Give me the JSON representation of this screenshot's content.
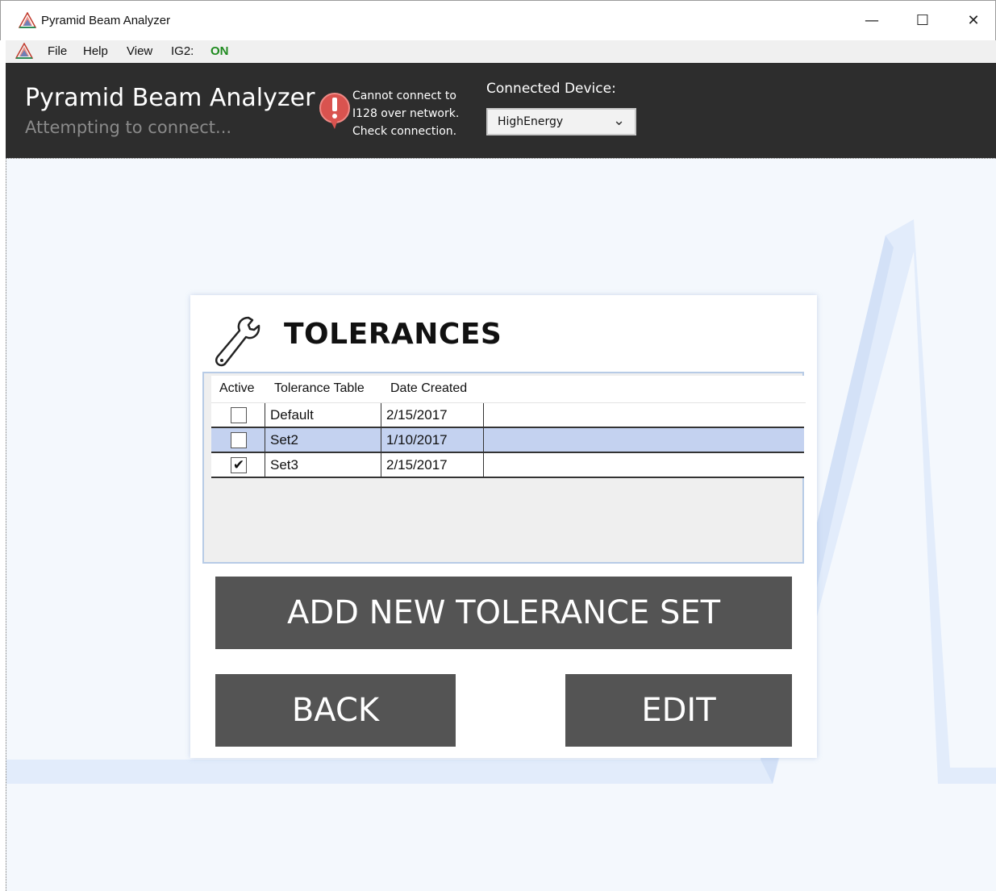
{
  "window": {
    "title": "Pyramid Beam Analyzer",
    "minimize_glyph": "—",
    "maximize_glyph": "☐",
    "close_glyph": "✕"
  },
  "menu": {
    "items": [
      "File",
      "Help",
      "View",
      "IG2:"
    ],
    "ig2_status": "ON",
    "ig2_status_color": "#1e8a1e"
  },
  "header": {
    "app_name": "Pyramid Beam Analyzer",
    "connection_status": "Attempting to connect...",
    "warning_lines": [
      "Cannot connect to",
      "I128 over network.",
      "Check connection."
    ],
    "device_label": "Connected Device:",
    "device_value": "HighEnergy",
    "device_chevron": "⌄"
  },
  "tolerances": {
    "title": "TOLERANCES",
    "columns": [
      "Active",
      "Tolerance Table",
      "Date Created"
    ],
    "rows": [
      {
        "active": false,
        "name": "Default",
        "date": "2/15/2017",
        "selected": false
      },
      {
        "active": false,
        "name": "Set2",
        "date": "1/10/2017",
        "selected": true
      },
      {
        "active": true,
        "name": "Set3",
        "date": "2/15/2017",
        "selected": false
      }
    ],
    "add_button": "ADD NEW TOLERANCE SET",
    "back_button": "BACK",
    "edit_button": "EDIT",
    "selected_row_color": "#c4d2f0",
    "button_color": "#545454"
  },
  "icons": {
    "app": "pyramid-logo-icon",
    "warning": "exclamation-warning-icon",
    "tolerances": "wrench-icon",
    "checkmark": "✔"
  }
}
